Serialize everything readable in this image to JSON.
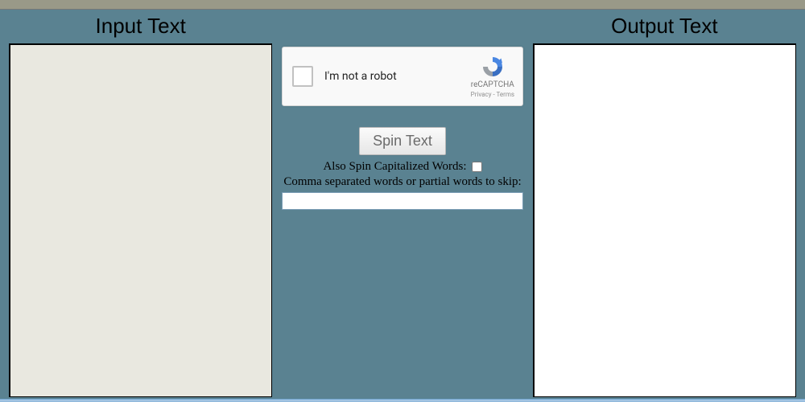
{
  "left": {
    "heading": "Input Text",
    "value": ""
  },
  "right": {
    "heading": "Output Text",
    "value": ""
  },
  "captcha": {
    "label": "I'm not a robot",
    "brand": "reCAPTCHA",
    "links": "Privacy - Terms"
  },
  "controls": {
    "spin_label": "Spin Text",
    "also_spin_label": "Also Spin Capitalized Words:",
    "skip_label": "Comma separated words or partial words to skip:",
    "skip_value": ""
  }
}
